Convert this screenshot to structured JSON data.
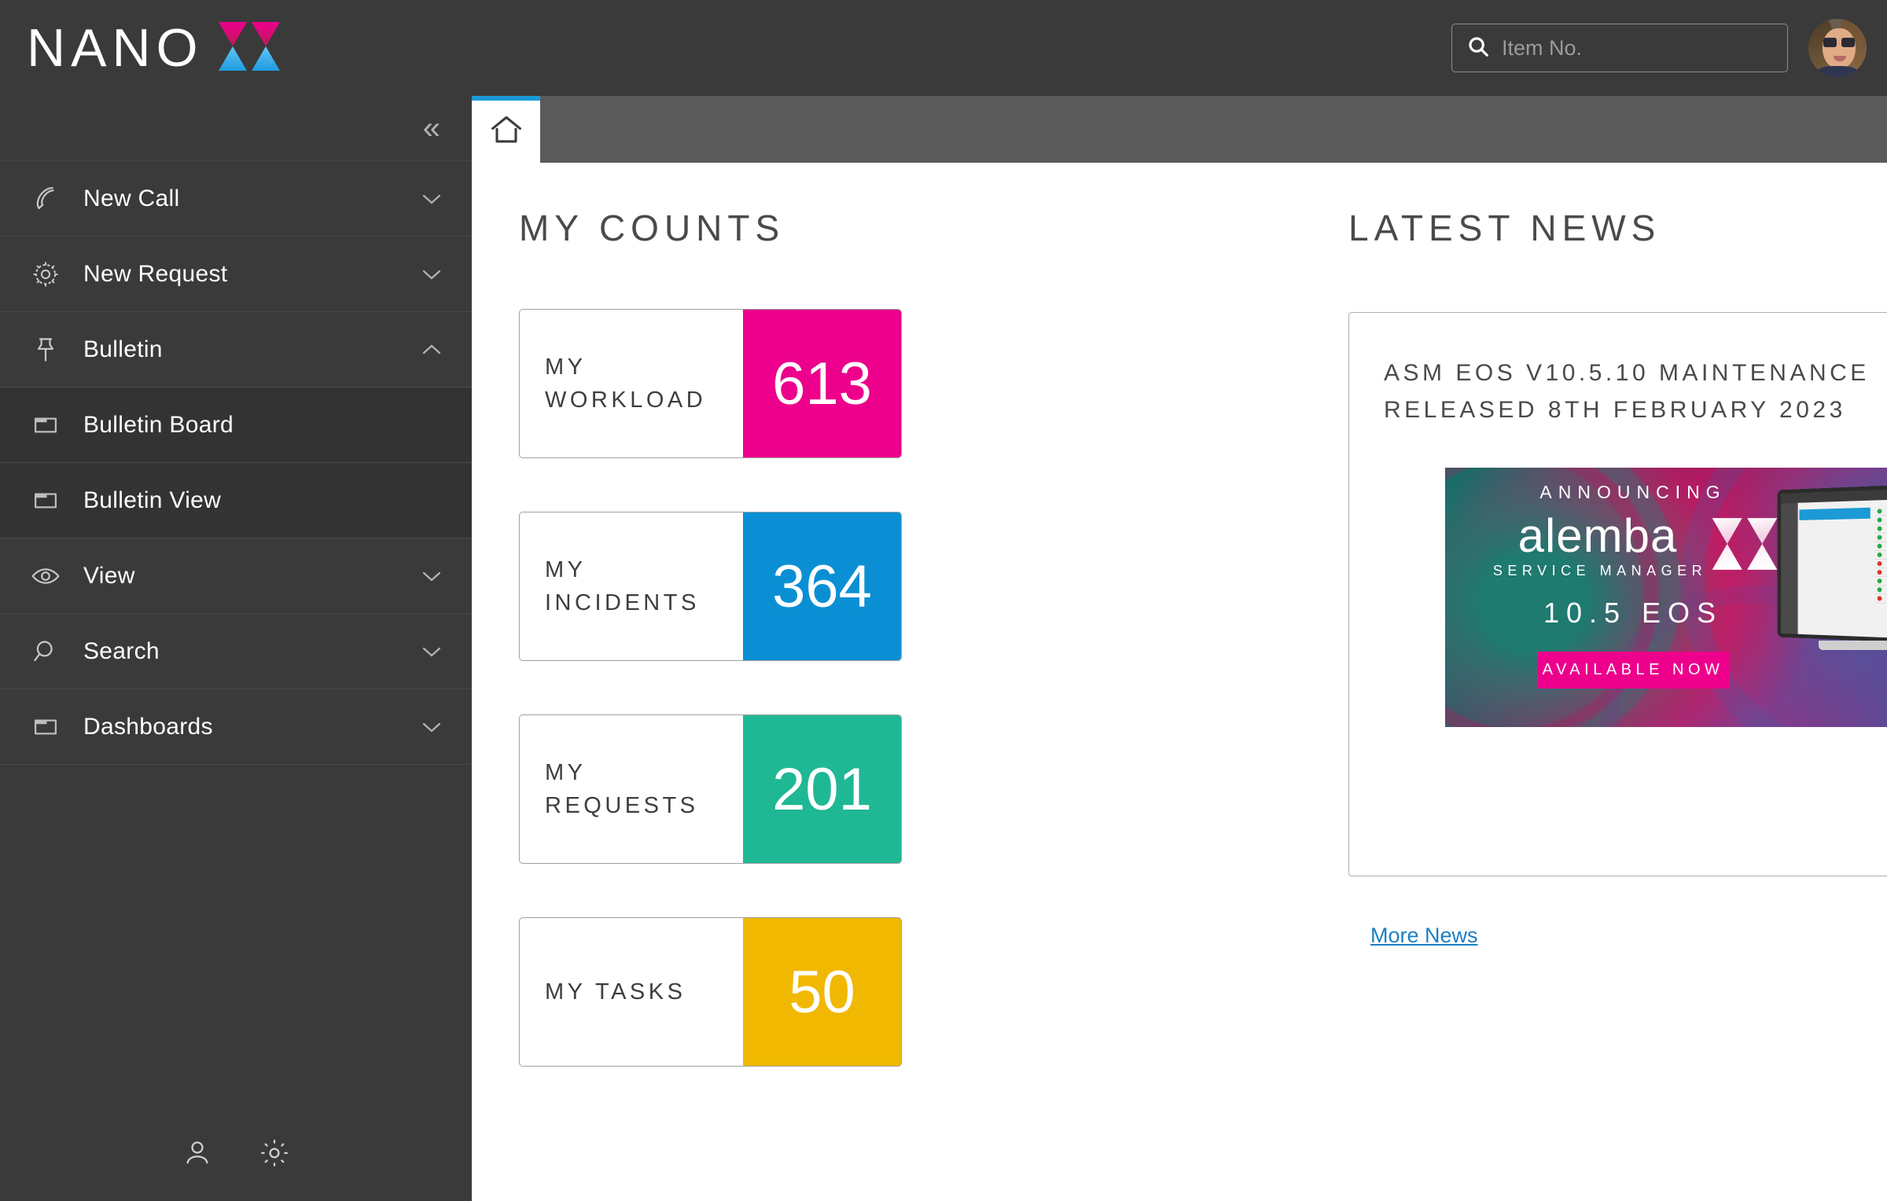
{
  "brand": {
    "word": "NANO",
    "logo_icon": "alemba-x-logo",
    "pink": "#e6007e",
    "magenta": "#d5006d",
    "blue": "#2196e8",
    "light_blue": "#63c6f5"
  },
  "header": {
    "search": {
      "icon": "search-icon",
      "placeholder": "Item No.",
      "value": ""
    },
    "avatar": {
      "icon": "user-avatar",
      "alt": "User profile photo"
    }
  },
  "sidebar": {
    "collapse": {
      "icon": "double-chevron-left-icon",
      "glyph": "«"
    },
    "items": [
      {
        "label": "New Call",
        "icon": "phone-icon",
        "chevron": "down",
        "sub": false
      },
      {
        "label": "New Request",
        "icon": "gear-icon",
        "chevron": "down",
        "sub": false
      },
      {
        "label": "Bulletin",
        "icon": "pin-icon",
        "chevron": "up",
        "sub": false
      },
      {
        "label": "Bulletin Board",
        "icon": "folder-icon",
        "chevron": "none",
        "sub": true
      },
      {
        "label": "Bulletin View",
        "icon": "folder-icon",
        "chevron": "none",
        "sub": true
      },
      {
        "label": "View",
        "icon": "eye-icon",
        "chevron": "down",
        "sub": false
      },
      {
        "label": "Search",
        "icon": "search-icon",
        "chevron": "down",
        "sub": false
      },
      {
        "label": "Dashboards",
        "icon": "folder-icon",
        "chevron": "down",
        "sub": false
      }
    ],
    "footer": [
      {
        "icon": "person-icon"
      },
      {
        "icon": "gear-icon"
      }
    ]
  },
  "tabs": [
    {
      "icon": "home-icon",
      "label": "",
      "active": true
    }
  ],
  "counts": {
    "title": "MY COUNTS",
    "tiles": [
      {
        "label": "MY WORKLOAD",
        "value": "613",
        "color": "#ec008c"
      },
      {
        "label": "MY INCIDENTS",
        "value": "364",
        "color": "#0b8fd4"
      },
      {
        "label": "MY REQUESTS",
        "value": "201",
        "color": "#1fb894"
      },
      {
        "label": "MY TASKS",
        "value": "50",
        "color": "#f0b800"
      }
    ]
  },
  "news": {
    "title": "LATEST NEWS",
    "headline_line1": "ASM EOS V10.5.10 MAINTENANCE",
    "headline_line2": "RELEASED 8TH FEBRUARY 2023",
    "banner": {
      "announcing": "ANNOUNCING",
      "product": "alemba",
      "product_sub": "SERVICE MANAGER",
      "version": "10.5  EOS",
      "cta": "AVAILABLE NOW",
      "logo_icon": "alemba-x-logo",
      "device_icon": "desktop-monitor-icon"
    },
    "more_link": "More News"
  }
}
